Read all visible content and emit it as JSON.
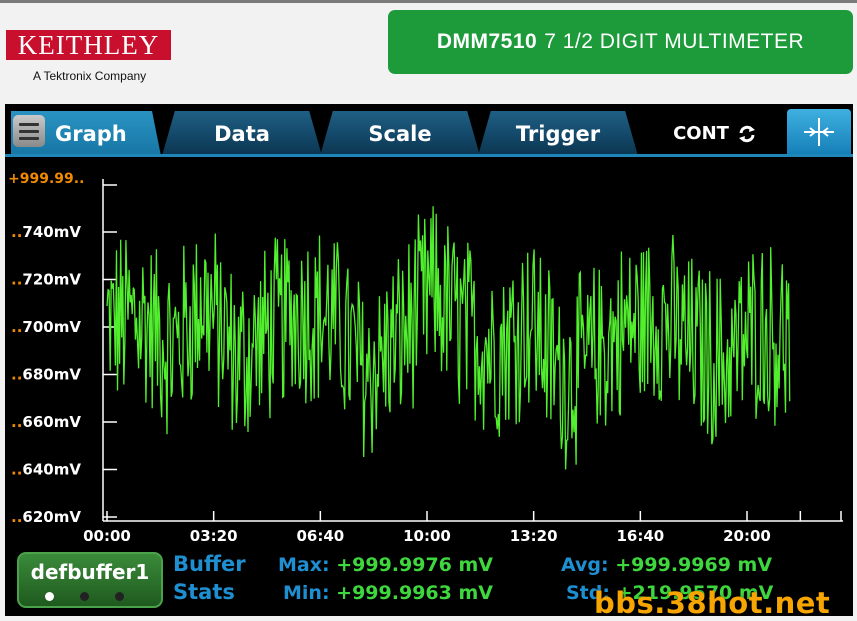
{
  "header": {
    "brand": "KEITHLEY",
    "tagline": "A Tektronix Company",
    "model": "DMM7510",
    "model_desc": "7 1/2 DIGIT MULTIMETER"
  },
  "tabs": [
    {
      "label": "Graph",
      "active": true
    },
    {
      "label": "Data",
      "active": false
    },
    {
      "label": "Scale",
      "active": false
    },
    {
      "label": "Trigger",
      "active": false
    }
  ],
  "trigger_mode": "CONT",
  "chart_data": {
    "type": "line",
    "color": "#52ef2e",
    "ylabel_ticks": [
      "+999.99..",
      "..740mV",
      "..720mV",
      "..700mV",
      "..680mV",
      "..660mV",
      "..640mV",
      "..620mV"
    ],
    "xticks": [
      "00:00",
      "03:20",
      "06:40",
      "10:00",
      "13:20",
      "16:40",
      "20:00"
    ],
    "x_seconds": [
      0,
      200,
      400,
      600,
      800,
      1000,
      1200
    ],
    "xlim": [
      0,
      1380
    ],
    "ylim": [
      620,
      755
    ],
    "ylabel_values": [
      740,
      720,
      700,
      680,
      660,
      640,
      620
    ],
    "data_xmax": 1280,
    "series": [
      {
        "segments_mean_mV": [
          700,
          705,
          690,
          712,
          685,
          698,
          708,
          702,
          680,
          695,
          715,
          700,
          690,
          705,
          678,
          688,
          700,
          705,
          692,
          685,
          700,
          695
        ],
        "sample_count": 650,
        "spread_mV": 40
      }
    ]
  },
  "stats": {
    "buffer_name": "defbuffer1",
    "title_line1": "Buffer",
    "title_line2": "Stats",
    "max_label": "Max:",
    "max_value": "+999.9976 mV",
    "min_label": "Min:",
    "min_value": "+999.9963 mV",
    "avg_label": "Avg:",
    "avg_value": "+999.9969 mV",
    "std_label": "Std:",
    "std_value": "+219.9570 mV"
  },
  "watermark": "bbs.38hot.net",
  "colors": {
    "brand_red": "#c8102e",
    "model_green": "#1d9a3a",
    "tab_blue": "#1e86b8",
    "trace_green": "#52ef2e",
    "axis_orange": "#f08a00",
    "stats_blue": "#1e8fd0",
    "stats_green": "#3ed83e"
  },
  "icons": {
    "menu": "hamburger-icon",
    "refresh": "refresh-icon",
    "swipe": "swipe-expand-icon"
  }
}
